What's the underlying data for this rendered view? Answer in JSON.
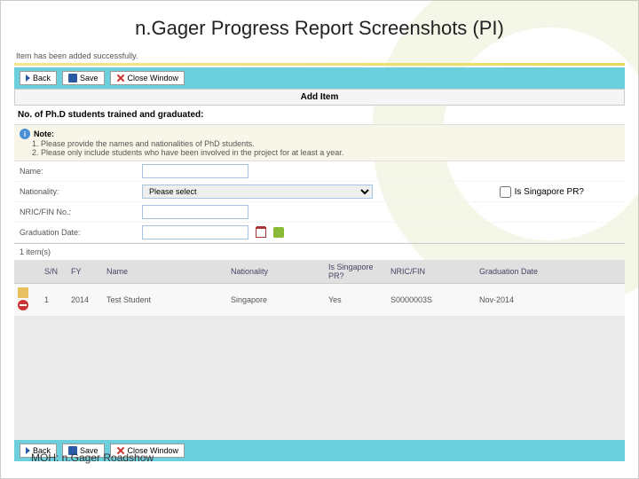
{
  "slide": {
    "title": "n.Gager Progress Report Screenshots (PI)"
  },
  "status": {
    "saved": "Item has been added successfully."
  },
  "toolbar": {
    "back": "Back",
    "save": "Save",
    "close": "Close Window"
  },
  "panel": {
    "title": "Add Item"
  },
  "section": {
    "title": "No. of Ph.D students trained and graduated:"
  },
  "note": {
    "head": "Note:",
    "items": [
      "Please provide the names and nationalities of PhD students.",
      "Please only include students who have been involved in the project for at least a year."
    ]
  },
  "form": {
    "name_lbl": "Name:",
    "nationality_lbl": "Nationality:",
    "nationality_placeholder": "Please select",
    "pr_lbl": "Is Singapore PR?",
    "nric_lbl": "NRIC/FIN No.:",
    "grad_lbl": "Graduation Date:"
  },
  "items": {
    "count": "1 item(s)"
  },
  "table": {
    "headers": {
      "sn": "S/N",
      "fy": "FY",
      "name": "Name",
      "nationality": "Nationality",
      "pr": "Is Singapore PR?",
      "nric": "NRIC/FIN",
      "grad": "Graduation Date"
    },
    "rows": [
      {
        "sn": "1",
        "fy": "2014",
        "name": "Test Student",
        "nationality": "Singapore",
        "pr": "Yes",
        "nric": "S0000003S",
        "grad": "Nov-2014"
      }
    ]
  },
  "footer": {
    "brand": "MOH: n.Gager Roadshow"
  }
}
